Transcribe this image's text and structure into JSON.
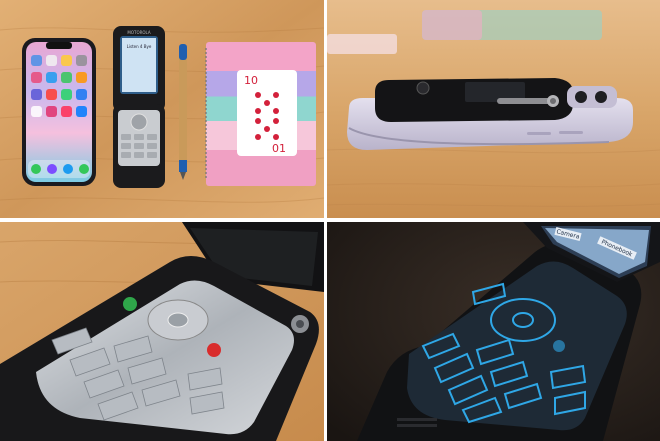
{
  "photos": {
    "top_left": {
      "phone_brand": "MOTOROLA",
      "flip_screen_text": "Listen 4 Bye",
      "card_rank_top": "10",
      "card_rank_bottom": "01"
    },
    "bottom_right": {
      "screen_tab_1": "Camera",
      "screen_tab_2": "Phonebook"
    }
  },
  "colors": {
    "wood_light": "#d9a66a",
    "wood_dark": "#b97a3e",
    "phone_black": "#1b1b1d",
    "iphone_lavender": "#cdc7dc",
    "keypad_blue": "#2fa7e6",
    "notebook_pink": "#f4a9c9",
    "notebook_teal": "#8fd6cf",
    "card_red": "#d3213b"
  }
}
